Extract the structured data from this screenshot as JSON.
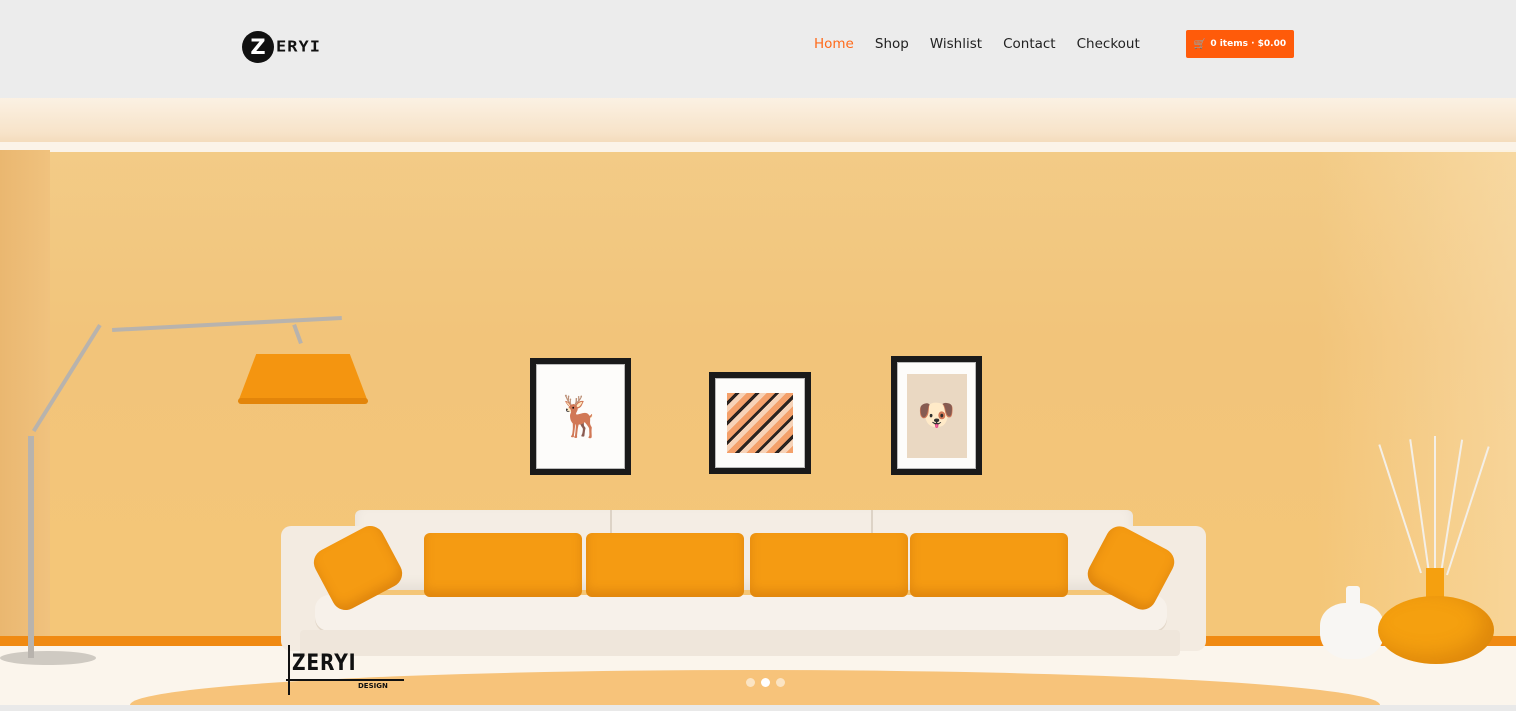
{
  "brand": {
    "logo_letter": "Z",
    "logo_word": "ERYI"
  },
  "nav": {
    "items": [
      "Home",
      "Shop",
      "Wishlist",
      "Contact",
      "Checkout"
    ],
    "active": "Home"
  },
  "cart": {
    "label": "0 items · $0.00",
    "icon": "cart-icon"
  },
  "hero": {
    "watermark_title": "ZERYI",
    "watermark_subtitle": "DESIGN",
    "slides_total": 3,
    "active_slide": 2
  },
  "colors": {
    "accent": "#ff5b0a",
    "nav_active": "#ff6a1a",
    "header_bg": "#ececec"
  }
}
